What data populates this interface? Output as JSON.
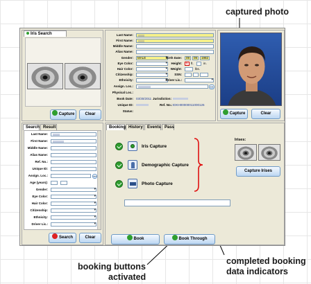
{
  "annotations": {
    "captured_photo": "captured photo",
    "booking_buttons": [
      "booking buttons",
      "activated"
    ],
    "completed_data": [
      "completed booking",
      "data indicators"
    ]
  },
  "iris_panel": {
    "tab": "Iris Search",
    "capture": "Capture",
    "clear": "Clear"
  },
  "details": {
    "last_name_label": "Last Name:",
    "first_name_label": "First Name:",
    "middle_name_label": "Middle Name:",
    "alias_label": "Alias Name:",
    "gender_label": "Gender:",
    "gender_value": "MALE",
    "eye_label": "Eye Color:",
    "hair_label": "Hair Color:",
    "citizenship_label": "Citizenship:",
    "ethnicity_label": "Ethnicity:",
    "assign_loc_label": "Assign. Loc.:",
    "physical_loc_label": "Physical Loc.:",
    "book_date_label": "Book Date:",
    "book_date_value": "03/30/2011",
    "jurisdiction_label": "Jurisdiction:",
    "unique_id_label": "Unique ID:",
    "ref_no_label": "Ref. No.:",
    "ref_no_value": "IDKH00000011000126",
    "status_label": "Status:",
    "birth_date_label": "Birth Date:",
    "birth_month": "09",
    "birth_day": "09",
    "birth_year": "1982",
    "height_label": "Height:",
    "height_ft": "5",
    "ft": "ft.",
    "in": "in.",
    "weight_label": "Weight:",
    "lbs": "lbs.",
    "ssn_label": "SSN:",
    "driver_lic_label": "Driver Lic.:"
  },
  "photo_panel": {
    "capture": "Capture",
    "clear": "Clear"
  },
  "search_panel": {
    "tabs": [
      "Search",
      "Result"
    ],
    "fields": [
      "Last Name:",
      "First Name:",
      "Middle Name:",
      "Alias Name:",
      "Ref. No.:",
      "Unique ID:",
      "Assign. Loc.:",
      "Age (years):",
      "Gender:",
      "Eye Color:",
      "Hair Color:",
      "Citizenship:",
      "Ethnicity:",
      "Driver Lic.:"
    ],
    "search": "Search",
    "clear": "Clear"
  },
  "booking_panel": {
    "tabs": [
      "Booking",
      "History",
      "Events",
      "Pass"
    ],
    "rows": [
      "Iris Capture",
      "Demographic Capture",
      "Photo Capture"
    ],
    "irises_label": "Irises:",
    "capture_irises": "Capture Irises",
    "book": "Book",
    "book_through": "Book Through"
  }
}
